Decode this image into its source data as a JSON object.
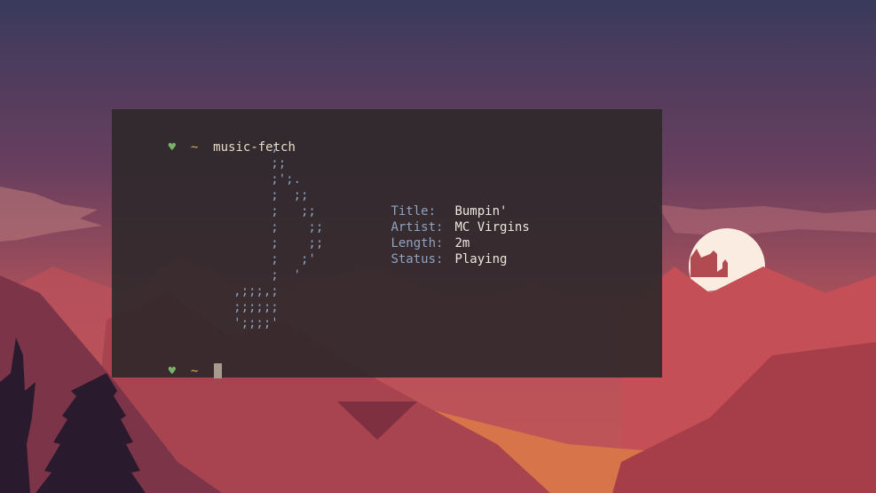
{
  "terminal": {
    "prompt_symbol": "♥",
    "prompt_dir": "~",
    "command": "music-fetch",
    "ascii_art": "          ;\n          ;;\n          ;';.\n          ;  ;;\n          ;   ;;\n          ;    ;;\n          ;    ;;\n          ;   ;'\n          ;  '\n     ,;;;,;\n     ;;;;;;\n     ';;;;'",
    "info": [
      {
        "key": "Title:",
        "value": "Bumpin'"
      },
      {
        "key": "Artist:",
        "value": "MC Virgins"
      },
      {
        "key": "Length:",
        "value": "2m"
      },
      {
        "key": "Status:",
        "value": "Playing"
      }
    ]
  },
  "colors": {
    "prompt_heart": "#7ab06a",
    "prompt_tilde": "#d6b04c",
    "ascii_and_keys": "#8ea4c2",
    "terminal_bg": "#2e282a"
  }
}
